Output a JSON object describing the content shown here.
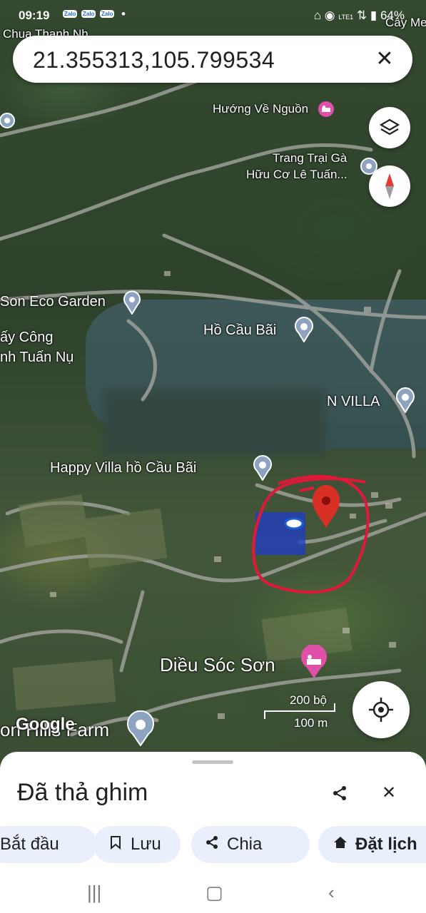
{
  "status_bar": {
    "time": "09:19",
    "zalo_badges": [
      "Zalo",
      "Zalo",
      "Zalo"
    ],
    "dot": "•",
    "network": "LTE1",
    "battery": "64%"
  },
  "search": {
    "query": "21.355313,105.799534"
  },
  "map": {
    "places": [
      {
        "name": "Hướng Về Nguồn",
        "kind": "hotel"
      },
      {
        "name": "Trang Trại Gà",
        "kind": "place"
      },
      {
        "name": "Hữu Cơ Lê Tuấn...",
        "kind": "place"
      },
      {
        "name": "Son Eco Garden",
        "kind": "place"
      },
      {
        "name": "ấy Công",
        "kind": "text"
      },
      {
        "name": "nh Tuấn Nụ",
        "kind": "text"
      },
      {
        "name": "Hồ Cầu Bãi",
        "kind": "place"
      },
      {
        "name": "N VILLA",
        "kind": "place"
      },
      {
        "name": "Happy Villa hồ Cầu Bãi",
        "kind": "place"
      },
      {
        "name": "Diều Sóc Sơn",
        "kind": "hotel"
      },
      {
        "name": "on Hills Farm",
        "kind": "place"
      },
      {
        "name": "Chua Thanh Nh",
        "kind": "text"
      },
      {
        "name": "Cây Me",
        "kind": "text"
      }
    ],
    "watermark": "Google",
    "scale": {
      "feet": "200 bộ",
      "meters": "100 m"
    },
    "pin_color": "#d93025",
    "annotation_color": "#e0193a"
  },
  "sheet": {
    "title": "Đã thả ghim",
    "chips": [
      {
        "label": "Bắt đầu",
        "icon": ""
      },
      {
        "label": "Lưu",
        "icon": "bookmark-icon"
      },
      {
        "label": "Chia",
        "icon": "share-icon"
      },
      {
        "label": "Đặt lịch",
        "icon": "home-icon"
      }
    ]
  }
}
